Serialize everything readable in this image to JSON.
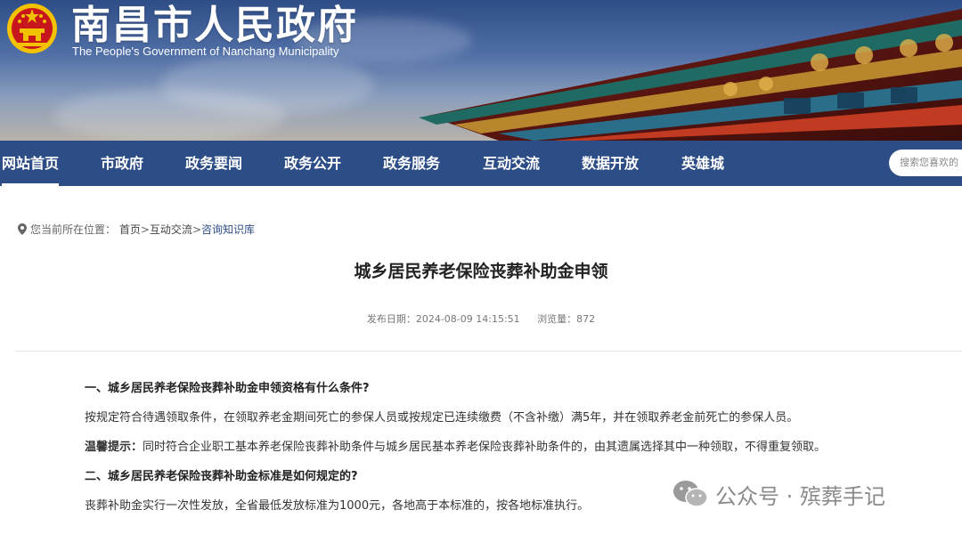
{
  "header": {
    "title": "南昌市人民政府",
    "subtitle": "The People's Government of Nanchang Municipality"
  },
  "nav": {
    "items": [
      "网站首页",
      "市政府",
      "政务要闻",
      "政务公开",
      "政务服务",
      "互动交流",
      "数据开放",
      "英雄城"
    ],
    "search_placeholder": "搜索您喜欢的"
  },
  "breadcrumb": {
    "prefix": "您当前所在位置：",
    "home": "首页",
    "sep1": ">",
    "section": "互动交流",
    "sep2": ">",
    "current": "咨询知识库"
  },
  "article": {
    "title": "城乡居民养老保险丧葬补助金申领",
    "publish_label": "发布日期：",
    "publish_date": "2024-08-09 14:15:51",
    "views_label": "浏览量：",
    "views": "872",
    "heading1": "一、城乡居民养老保险丧葬补助金申领资格有什么条件?",
    "para1": "按规定符合待遇领取条件，在领取养老金期间死亡的参保人员或按规定已连续缴费（不含补缴）满5年，并在领取养老金前死亡的参保人员。",
    "tip_label": "温馨提示：",
    "tip_text": "同时符合企业职工基本养老保险丧葬补助条件与城乡居民基本养老保险丧葬补助条件的，由其遗属选择其中一种领取，不得重复领取。",
    "heading2": "二、城乡居民养老保险丧葬补助金标准是如何规定的?",
    "para2": "丧葬补助金实行一次性发放，全省最低发放标准为1000元，各地高于本标准的，按各地标准执行。"
  },
  "watermark": {
    "text": "公众号 · 殡葬手记",
    "icon": "wechat-icon"
  },
  "colors": {
    "nav_bg": "#2d4d86",
    "emblem_red": "#c8161d",
    "emblem_gold": "#f2c200"
  }
}
